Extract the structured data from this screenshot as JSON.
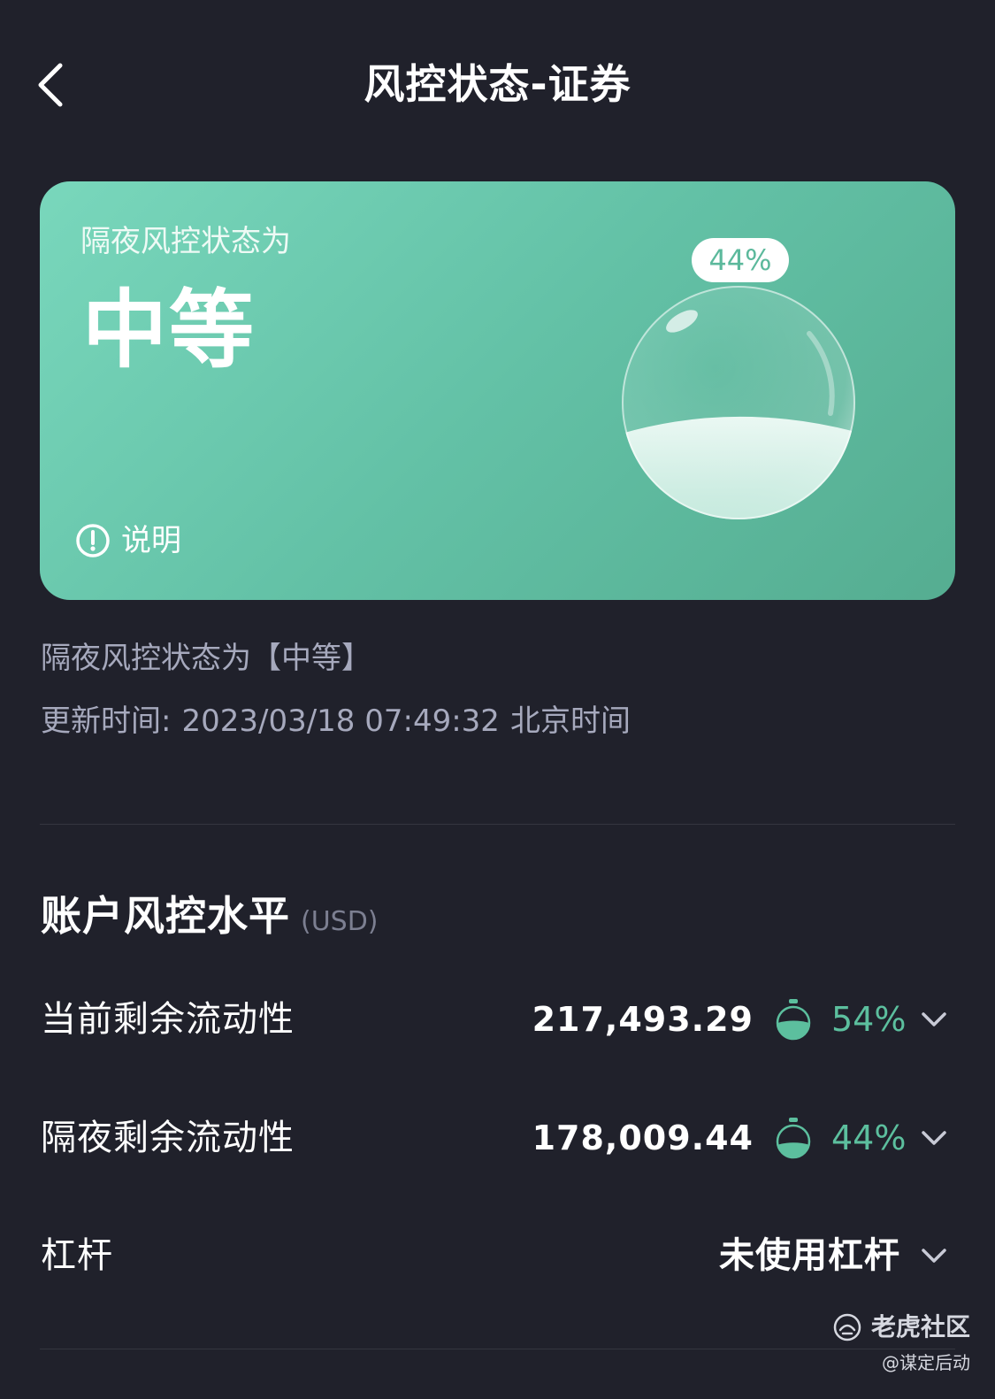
{
  "header": {
    "title": "风控状态-证券",
    "back_icon": "chevron-left-icon"
  },
  "card": {
    "subtitle": "隔夜风控状态为",
    "level": "中等",
    "explain_label": "说明",
    "explain_icon": "exclamation-circle-icon",
    "bubble_percent_label": "44%",
    "bubble_fill_fraction": 0.44,
    "gradient_start": "#79d7bc",
    "gradient_end": "#55ad91"
  },
  "status": {
    "summary": "隔夜风控状态为【中等】",
    "update_label": "更新时间:",
    "update_time": "2023/03/18 07:49:32",
    "update_zone": "北京时间"
  },
  "section": {
    "title": "账户风控水平",
    "unit": "(USD)"
  },
  "rows": [
    {
      "label": "当前剩余流动性",
      "value": "217,493.29",
      "percent": "54%",
      "fill_fraction": 0.54,
      "icon": "gauge-icon",
      "expand_icon": "chevron-down-icon"
    },
    {
      "label": "隔夜剩余流动性",
      "value": "178,009.44",
      "percent": "44%",
      "fill_fraction": 0.44,
      "icon": "gauge-icon",
      "expand_icon": "chevron-down-icon"
    },
    {
      "label": "杠杆",
      "value": "未使用杠杆",
      "expand_icon": "chevron-down-icon"
    }
  ],
  "watermark": {
    "brand": "老虎社区",
    "user": "@谋定后动",
    "brand_icon": "tiger-logo-icon"
  },
  "colors": {
    "background": "#20212b",
    "accent": "#5cbf9e",
    "muted_text": "#a6a9bd",
    "divider": "#34363f"
  }
}
